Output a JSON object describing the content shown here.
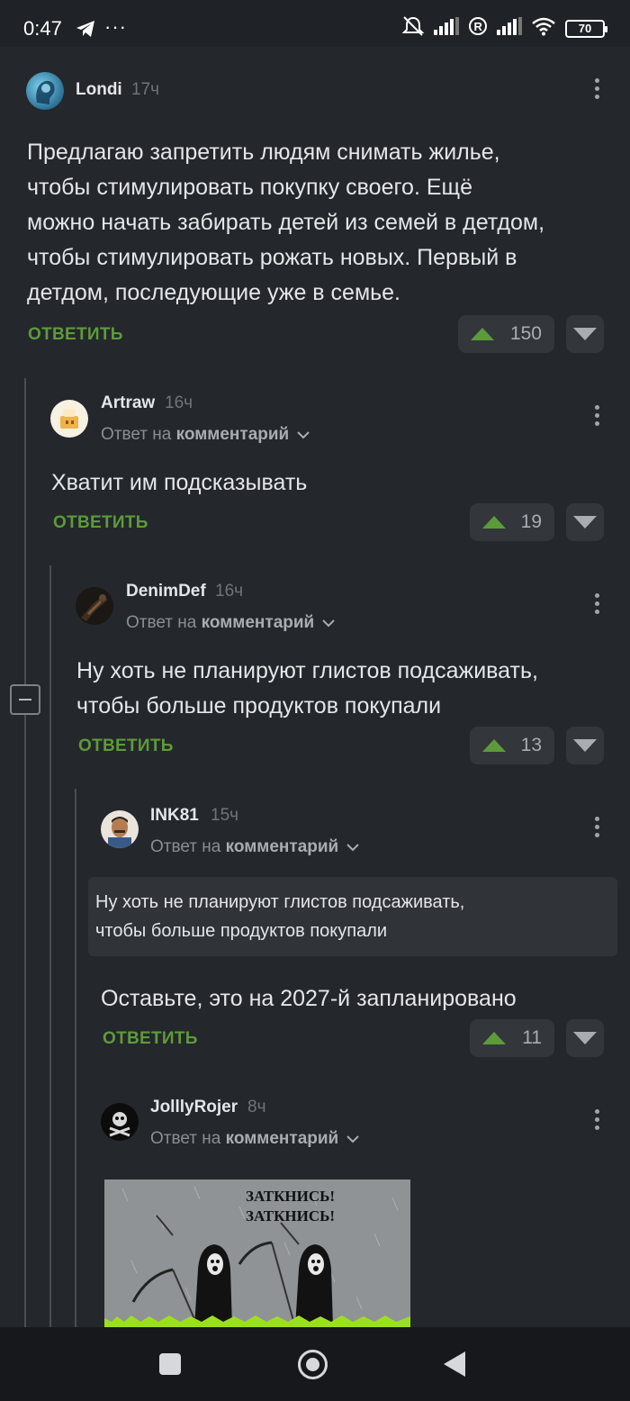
{
  "status_bar": {
    "time": "0:47",
    "dots": "···",
    "battery": "70",
    "icons": [
      "telegram-icon",
      "mute-alarm-icon",
      "signal-icon",
      "roaming-icon",
      "signal-icon",
      "wifi-icon",
      "battery-icon"
    ]
  },
  "comments": [
    {
      "username": "Londi",
      "time": "17ч",
      "text_lines": [
        "Предлагаю запретить людям снимать жилье,",
        "чтобы стимулировать покупку своего. Ещё",
        "можно начать забирать детей из семей в детдом,",
        "чтобы стимулировать рожать новых. Первый в",
        "детдом, последующие уже в семье."
      ],
      "reply_label": "ОТВЕТИТЬ",
      "rating": "150"
    },
    {
      "username": "Artraw",
      "time": "16ч",
      "reply_to_prefix": "Ответ на",
      "reply_to_target": "комментарий",
      "text_lines": [
        "Хватит им подсказывать"
      ],
      "reply_label": "ОТВЕТИТЬ",
      "rating": "19"
    },
    {
      "username": "DenimDef",
      "time": "16ч",
      "reply_to_prefix": "Ответ на",
      "reply_to_target": "комментарий",
      "text_lines": [
        "Ну хоть не планируют глистов подсаживать,",
        "чтобы больше продуктов покупали"
      ],
      "reply_label": "ОТВЕТИТЬ",
      "rating": "13"
    },
    {
      "username": "INK81",
      "time": "15ч",
      "reply_to_prefix": "Ответ на",
      "reply_to_target": "комментарий",
      "quote_lines": [
        "Ну хоть не планируют глистов подсаживать,",
        "чтобы больше продуктов покупали"
      ],
      "text_lines": [
        "Оставьте, это на 2027-й запланировано"
      ],
      "reply_label": "ОТВЕТИТЬ",
      "rating": "11"
    },
    {
      "username": "JolllyRojer",
      "time": "8ч",
      "reply_to_prefix": "Ответ на",
      "reply_to_target": "комментарий",
      "meme_lines": [
        "ЗАТКНИСЬ!",
        "ЗАТКНИСЬ!"
      ]
    }
  ],
  "colors": {
    "background": "#24272b",
    "accent_green": "#5d9b3a",
    "vote_bg": "#33373c"
  }
}
